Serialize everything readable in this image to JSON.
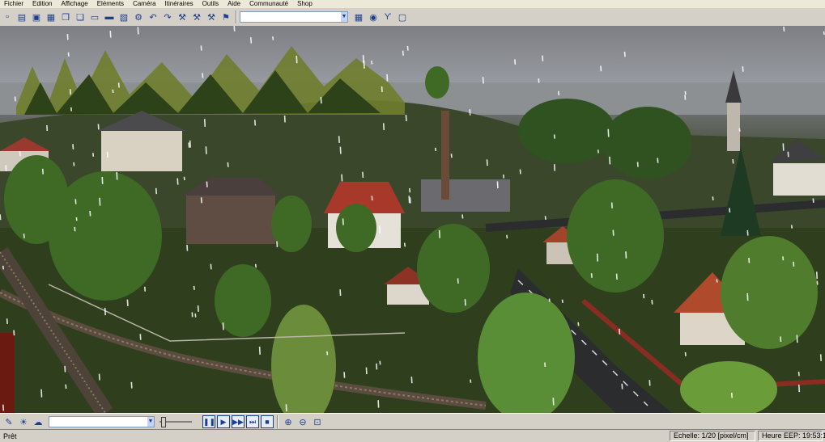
{
  "menu": [
    "Fichier",
    "Edition",
    "Affichage",
    "Eléments",
    "Caméra",
    "Itinéraires",
    "Outils",
    "Aide",
    "Communauté",
    "Shop"
  ],
  "toolbar": {
    "icons": [
      "new-icon",
      "open-icon",
      "save-icon",
      "save-as-icon",
      "copy-icon",
      "paste-icon",
      "print-icon",
      "preview-icon",
      "export-icon",
      "settings-icon",
      "undo-icon",
      "redo-icon",
      "track-edit-icon",
      "road-edit-icon",
      "tram-edit-icon",
      "water-edit-icon"
    ],
    "glyphs": [
      "▫",
      "▤",
      "▣",
      "▦",
      "❐",
      "❏",
      "▭",
      "▬",
      "▧",
      "⚙",
      "↶",
      "↷",
      "⚒",
      "⚒",
      "⚒",
      "⚑"
    ],
    "combo_value": "",
    "right_icons": [
      "map-icon",
      "globe-icon",
      "tools-icon",
      "info-icon"
    ],
    "right_glyphs": [
      "▦",
      "◉",
      "ϒ",
      "▢"
    ]
  },
  "bottom": {
    "left_icons": [
      "edit-icon",
      "light-icon",
      "weather-icon"
    ],
    "left_glyphs": [
      "✎",
      "☀",
      "☁"
    ],
    "combo_value": "",
    "play_icons": [
      "pause-icon",
      "play-icon",
      "forward-icon",
      "fast-forward-icon",
      "stop-icon"
    ],
    "play_glyphs": [
      "❚❚",
      "▶",
      "▶▶",
      "⏭",
      "■"
    ],
    "zoom_icons": [
      "zoom-in-icon",
      "zoom-out-icon",
      "zoom-reset-icon"
    ],
    "zoom_glyphs": [
      "⊕",
      "⊖",
      "⊡"
    ]
  },
  "status": {
    "ready": "Prêt",
    "scale": "Echelle:  1/20 [pixel/cm]",
    "time": "Heure EEP:  19:53:1"
  },
  "colors": {
    "sky": "#8e9196",
    "grass": "#37461f",
    "accent": "#1b3f8f"
  }
}
